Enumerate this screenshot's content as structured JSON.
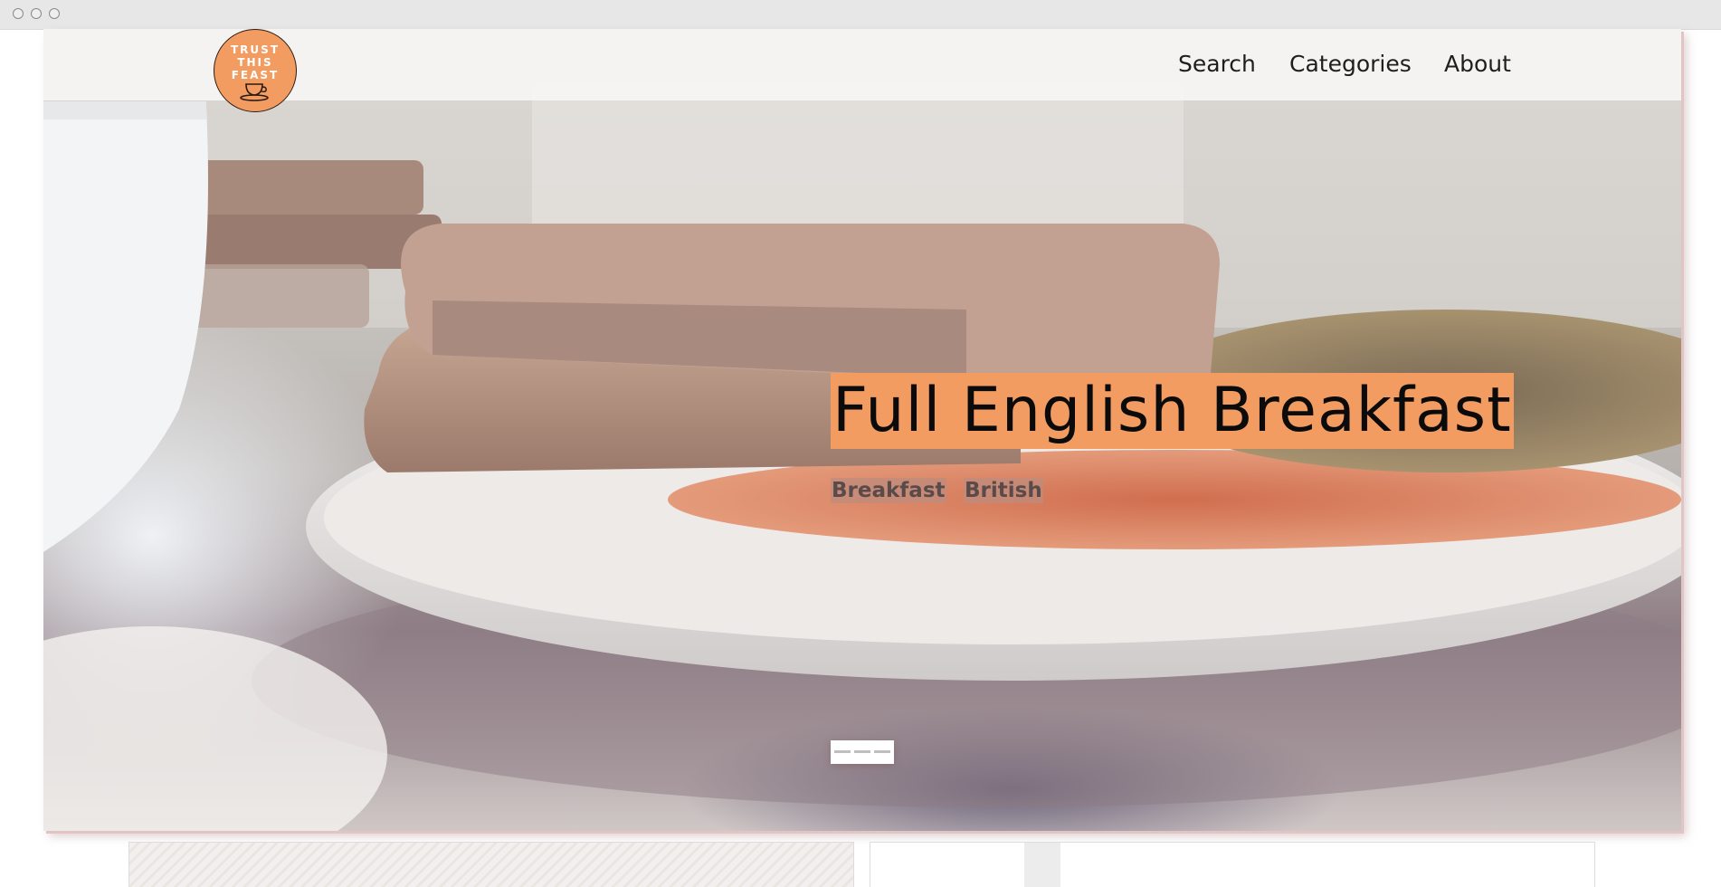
{
  "window": {
    "controls": [
      "close-dot",
      "minimize-dot",
      "zoom-dot"
    ]
  },
  "header": {
    "logo": {
      "lines": [
        "TRUST",
        "THIS",
        "FEAST"
      ],
      "icon": "teacup-icon"
    },
    "nav": [
      {
        "label": "Search"
      },
      {
        "label": "Categories"
      },
      {
        "label": "About"
      }
    ]
  },
  "hero": {
    "title": "Full English Breakfast",
    "tags": [
      "Breakfast",
      "British"
    ],
    "accent_color": "#f39c62",
    "image": "breakfast-photo"
  },
  "cards": [
    {
      "image": "marble-texture"
    },
    {
      "image": "plate-photo"
    }
  ]
}
